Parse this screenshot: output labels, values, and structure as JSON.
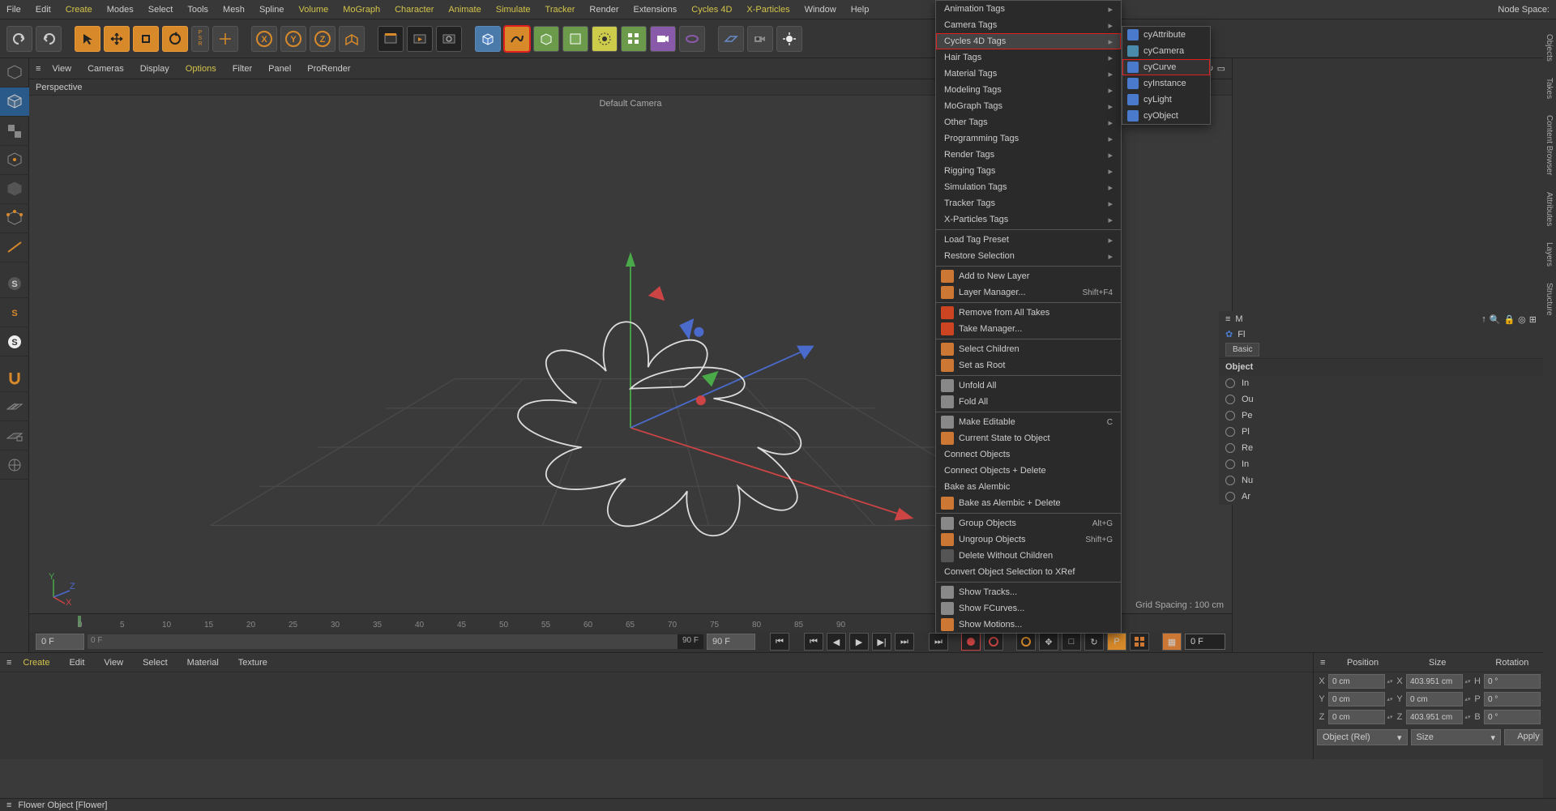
{
  "menubar": {
    "items": [
      "File",
      "Edit",
      "Create",
      "Modes",
      "Select",
      "Tools",
      "Mesh",
      "Spline",
      "Volume",
      "MoGraph",
      "Character",
      "Animate",
      "Simulate",
      "Tracker",
      "Render",
      "Extensions",
      "Cycles 4D",
      "X-Particles",
      "Window",
      "Help"
    ],
    "yellow_items": [
      "Create",
      "Volume",
      "MoGraph",
      "Character",
      "Animate",
      "Simulate",
      "Tracker",
      "Cycles 4D",
      "X-Particles"
    ],
    "node_space_label": "Node Space:"
  },
  "viewport": {
    "tabs": [
      "View",
      "Cameras",
      "Display",
      "Options",
      "Filter",
      "Panel",
      "ProRender"
    ],
    "yellow_tabs": [
      "Options"
    ],
    "label": "Perspective",
    "default_camera": "Default Camera",
    "grid_spacing": "Grid Spacing : 100 cm"
  },
  "ctx": {
    "groups": [
      [
        {
          "label": "Animation Tags",
          "arrow": true,
          "yellow": true
        },
        {
          "label": "Camera Tags",
          "arrow": true
        },
        {
          "label": "Cycles 4D Tags",
          "arrow": true,
          "yellow": true,
          "highlighted": true
        },
        {
          "label": "Hair Tags",
          "arrow": true,
          "yellow": true
        },
        {
          "label": "Material Tags",
          "arrow": true,
          "yellow": true
        },
        {
          "label": "Modeling Tags",
          "arrow": true
        },
        {
          "label": "MoGraph Tags",
          "arrow": true,
          "yellow": true
        },
        {
          "label": "Other Tags",
          "arrow": true
        },
        {
          "label": "Programming Tags",
          "arrow": true,
          "yellow": true
        },
        {
          "label": "Render Tags",
          "arrow": true,
          "yellow": true
        },
        {
          "label": "Rigging Tags",
          "arrow": true
        },
        {
          "label": "Simulation Tags",
          "arrow": true
        },
        {
          "label": "Tracker Tags",
          "arrow": true
        },
        {
          "label": "X-Particles Tags",
          "arrow": true,
          "yellow": true
        }
      ],
      [
        {
          "label": "Load Tag Preset",
          "arrow": true
        },
        {
          "label": "Restore Selection",
          "arrow": true
        }
      ],
      [
        {
          "label": "Add to New Layer",
          "icon": "#cc7733"
        },
        {
          "label": "Layer Manager...",
          "shortcut": "Shift+F4",
          "icon": "#cc7733"
        }
      ],
      [
        {
          "label": "Remove from All Takes",
          "icon": "#cc4422"
        },
        {
          "label": "Take Manager...",
          "icon": "#cc4422"
        }
      ],
      [
        {
          "label": "Select Children",
          "icon": "#cc7733"
        },
        {
          "label": "Set as Root",
          "icon": "#cc7733"
        }
      ],
      [
        {
          "label": "Unfold All",
          "icon": "#888"
        },
        {
          "label": "Fold All",
          "icon": "#888"
        }
      ],
      [
        {
          "label": "Make Editable",
          "shortcut": "C",
          "icon": "#888"
        },
        {
          "label": "Current State to Object",
          "icon": "#cc7733"
        },
        {
          "label": "Connect Objects",
          "disabled": true
        },
        {
          "label": "Connect Objects + Delete",
          "disabled": true
        },
        {
          "label": "Bake as Alembic"
        },
        {
          "label": "Bake as Alembic + Delete",
          "icon": "#cc7733"
        }
      ],
      [
        {
          "label": "Group Objects",
          "shortcut": "Alt+G",
          "icon": "#888"
        },
        {
          "label": "Ungroup Objects",
          "shortcut": "Shift+G",
          "icon": "#cc7733"
        },
        {
          "label": "Delete Without Children",
          "icon": "#555"
        },
        {
          "label": "Convert Object Selection to XRef"
        }
      ],
      [
        {
          "label": "Show Tracks...",
          "icon": "#888"
        },
        {
          "label": "Show FCurves...",
          "icon": "#888"
        },
        {
          "label": "Show Motions...",
          "icon": "#cc7733"
        }
      ]
    ]
  },
  "submenu": {
    "items": [
      {
        "label": "cyAttribute",
        "icon": "#4a7acc"
      },
      {
        "label": "cyCamera",
        "icon": "#4a8aaa"
      },
      {
        "label": "cyCurve",
        "icon": "#4a7acc",
        "highlighted": true
      },
      {
        "label": "cyInstance",
        "icon": "#4a7acc"
      },
      {
        "label": "cyLight",
        "icon": "#4a7acc"
      },
      {
        "label": "cyObject",
        "icon": "#4a7acc"
      }
    ]
  },
  "timeline": {
    "ticks": [
      "0",
      "5",
      "10",
      "15",
      "20",
      "25",
      "30",
      "35",
      "40",
      "45",
      "50",
      "55",
      "60",
      "65",
      "70",
      "75",
      "80",
      "85",
      "90"
    ],
    "start": "0 F",
    "slider_start": "0 F",
    "slider_end": "90 F",
    "end": "90 F",
    "val_right": "0 F"
  },
  "materials": {
    "tabs": [
      "Create",
      "Edit",
      "View",
      "Select",
      "Material",
      "Texture"
    ],
    "yellow_tabs": [
      "Create"
    ]
  },
  "coords": {
    "headers": [
      "Position",
      "Size",
      "Rotation"
    ],
    "rows": [
      {
        "axis": "X",
        "p": "0 cm",
        "s": "403.951 cm",
        "rlabel": "H",
        "r": "0 °"
      },
      {
        "axis": "Y",
        "p": "0 cm",
        "s": "0 cm",
        "rlabel": "P",
        "r": "0 °"
      },
      {
        "axis": "Z",
        "p": "0 cm",
        "s": "403.951 cm",
        "rlabel": "B",
        "r": "0 °"
      }
    ],
    "mode1": "Object (Rel)",
    "mode2": "Size",
    "apply": "Apply"
  },
  "attr": {
    "hdr_label": "M",
    "title": "Fl",
    "tabs": [
      "Basic"
    ],
    "section": "Object",
    "rows": [
      "In",
      "Ou",
      "Pe",
      "Pl",
      "Re",
      "In",
      "Nu",
      "Ar"
    ]
  },
  "right_tabs": [
    "Objects",
    "Takes",
    "Content Browser",
    "Attributes",
    "Layers",
    "Structure"
  ],
  "status": "Flower Object [Flower]"
}
